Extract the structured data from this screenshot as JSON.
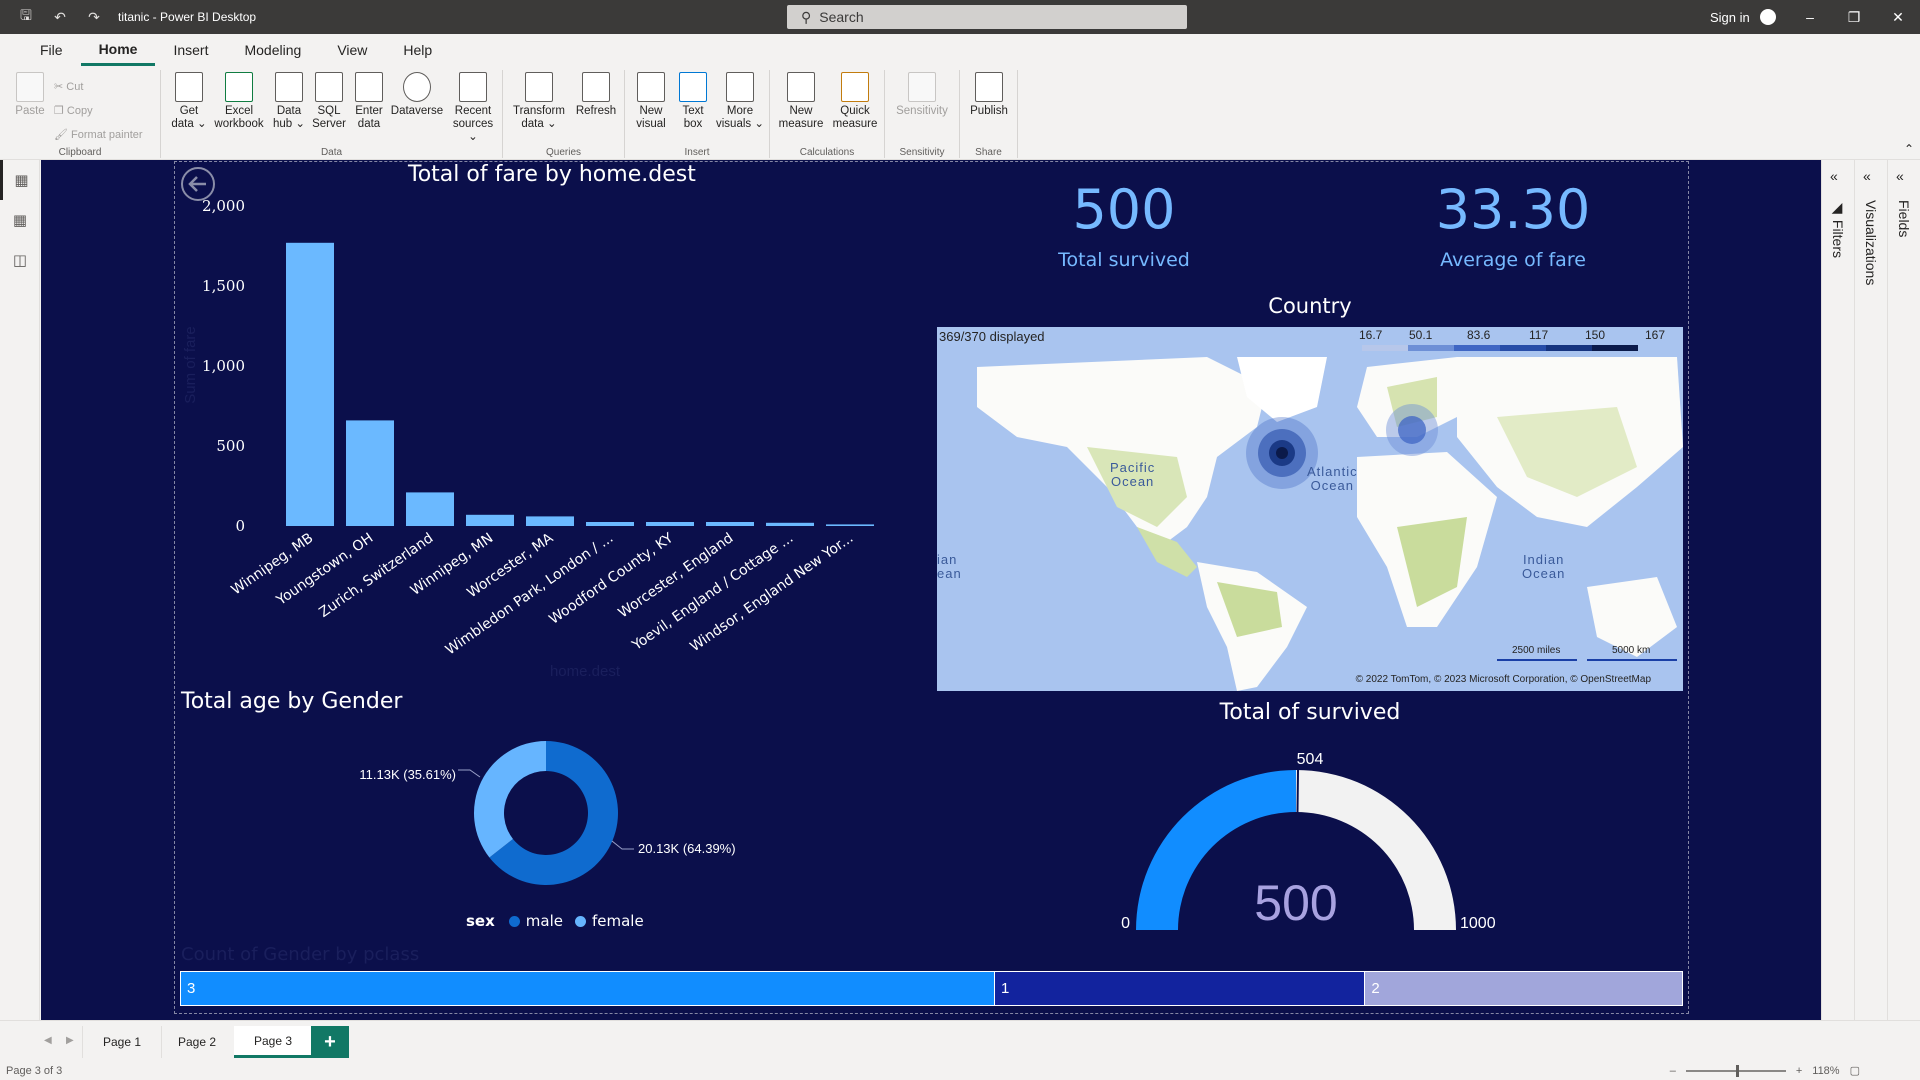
{
  "app": {
    "window_title": "titanic - Power BI Desktop",
    "search_placeholder": "Search",
    "signin_label": "Sign in"
  },
  "menu": [
    "File",
    "Home",
    "Insert",
    "Modeling",
    "View",
    "Help"
  ],
  "ribbon": {
    "clipboard": {
      "paste": "Paste",
      "cut": "Cut",
      "copy": "Copy",
      "format_painter": "Format painter",
      "label": "Clipboard"
    },
    "data": {
      "get_data": "Get data ⌄",
      "excel": "Excel workbook",
      "hub": "Data hub ⌄",
      "sql": "SQL Server",
      "enter": "Enter data",
      "dataverse": "Dataverse",
      "recent": "Recent sources ⌄",
      "label": "Data"
    },
    "queries": {
      "transform": "Transform data ⌄",
      "refresh": "Refresh",
      "label": "Queries"
    },
    "insert": {
      "new_visual": "New visual",
      "text_box": "Text box",
      "more_visuals": "More visuals ⌄",
      "label": "Insert"
    },
    "calc": {
      "new_measure": "New measure",
      "quick_measure": "Quick measure",
      "label": "Calculations"
    },
    "sensitivity": {
      "btn": "Sensitivity",
      "label": "Sensitivity"
    },
    "share": {
      "publish": "Publish",
      "label": "Share"
    }
  },
  "panes": {
    "filters": "Filters",
    "visualizations": "Visualizations",
    "fields": "Fields"
  },
  "cards": {
    "survived_value": "500",
    "survived_label": "Total survived",
    "fare_value": "33.30",
    "fare_label": "Average of fare"
  },
  "map": {
    "title": "Country",
    "displayed": "369/370 displayed",
    "legend": [
      "16.7",
      "50.1",
      "83.6",
      "117",
      "150",
      "167"
    ],
    "legend_colors": [
      "#b7c7ea",
      "#6d8fd6",
      "#3f66c4",
      "#274da8",
      "#16347f",
      "#0b1a4a"
    ],
    "oceans": [
      {
        "name": "Pacific\nOcean",
        "key": "pacific"
      },
      {
        "name": "Atlantic\nOcean",
        "key": "atlantic"
      },
      {
        "name": "Indian\nOcean",
        "key": "indian"
      },
      {
        "name": "ian\nean",
        "key": "ian"
      }
    ],
    "scale_miles": "2500 miles",
    "scale_km": "5000 km",
    "attribution": "© 2022 TomTom, © 2023 Microsoft Corporation, © OpenStreetMap"
  },
  "donut_title": "Total age by Gender",
  "gauge_title": "Total of survived",
  "stack_title": "Count of Gender by pclass",
  "tabs": [
    "Page 1",
    "Page 2",
    "Page 3"
  ],
  "status": {
    "page_info": "Page 3 of 3",
    "zoom": "118%"
  },
  "chart_data": [
    {
      "type": "bar",
      "title": "Total of fare by home.dest",
      "xlabel": "home.dest",
      "ylabel": "Sum of fare",
      "ylim": [
        0,
        2000
      ],
      "yticks": [
        "2,000",
        "1,500",
        "1,000",
        "500",
        "0"
      ],
      "categories": [
        "Winnipeg, MB",
        "Youngstown, OH",
        "Zurich, Switzerland",
        "Winnipeg, MN",
        "Worcester, MA",
        "Wimbledon Park, London / ...",
        "Woodford County, KY",
        "Worcester, England",
        "Yoevil, England / Cottage ...",
        "Windsor, England New Yor..."
      ],
      "values": [
        1770,
        660,
        210,
        70,
        60,
        25,
        25,
        25,
        20,
        10
      ],
      "color": "#6bb9ff"
    },
    {
      "type": "pie",
      "title": "Total age by Gender",
      "legend_title": "sex",
      "labels": [
        "male",
        "female"
      ],
      "values": [
        20130,
        11130
      ],
      "data_labels": [
        "20.13K (64.39%)",
        "11.13K (35.61%)"
      ],
      "colors": [
        "#0f6bcf",
        "#66b5ff"
      ]
    },
    {
      "type": "gauge",
      "title": "Total of survived",
      "value": 500,
      "value_label": "500",
      "min": 0,
      "min_label": "0",
      "max": 1000,
      "max_label": "1000",
      "target": 504,
      "target_label": "504",
      "fill_color": "#118dff",
      "rest_color": "#f2f2f2"
    },
    {
      "type": "bar",
      "title": "Count of Gender by pclass",
      "categories": [
        "3",
        "1",
        "2"
      ],
      "values": [
        709,
        323,
        277
      ],
      "colors": [
        "#118dff",
        "#12239e",
        "#a1a6db"
      ]
    }
  ]
}
